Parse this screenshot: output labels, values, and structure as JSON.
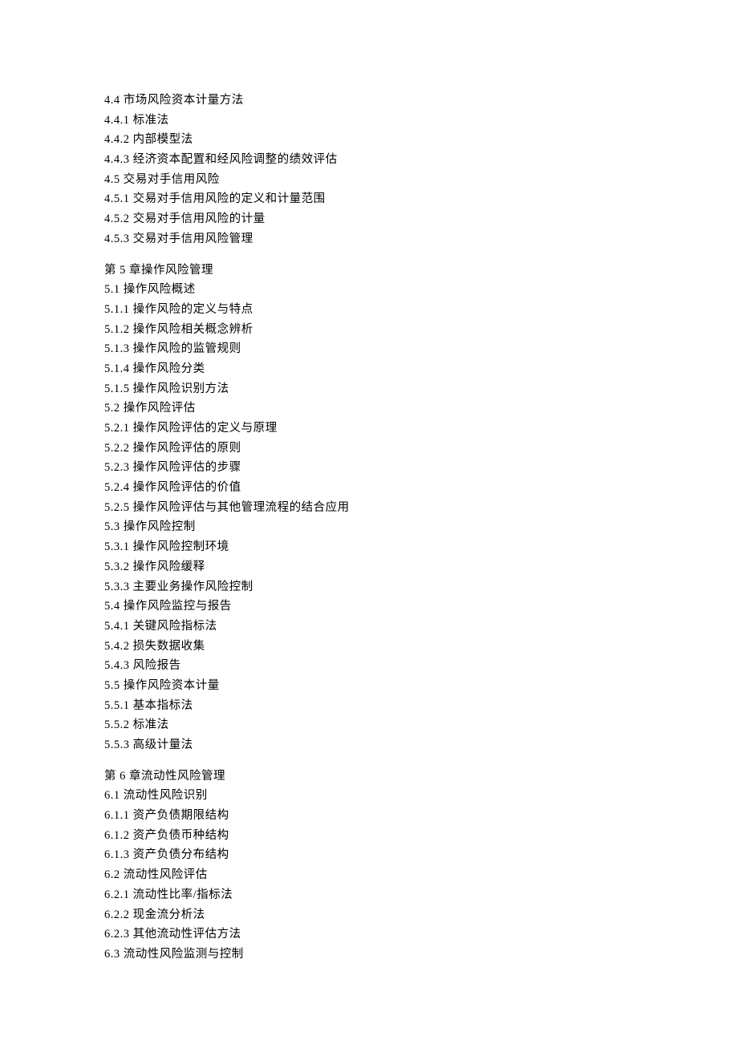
{
  "toc": {
    "blocks": [
      {
        "lines": [
          "4.4 市场风险资本计量方法",
          "4.4.1 标准法",
          "4.4.2 内部模型法",
          "4.4.3 经济资本配置和经风险调整的绩效评估",
          "4.5 交易对手信用风险",
          "4.5.1 交易对手信用风险的定义和计量范围",
          "4.5.2 交易对手信用风险的计量",
          "4.5.3 交易对手信用风险管理"
        ]
      },
      {
        "lines": [
          "第 5 章操作风险管理",
          "5.1 操作风险概述",
          "5.1.1 操作风险的定义与特点",
          "5.1.2 操作风险相关概念辨析",
          "5.1.3 操作风险的监管规则",
          "5.1.4 操作风险分类",
          "5.1.5 操作风险识别方法",
          "5.2 操作风险评估",
          "5.2.1 操作风险评估的定义与原理",
          "5.2.2 操作风险评估的原则",
          "5.2.3 操作风险评估的步骤",
          "5.2.4 操作风险评估的价值",
          "5.2.5 操作风险评估与其他管理流程的结合应用",
          "5.3 操作风险控制",
          "5.3.1 操作风险控制环境",
          "5.3.2 操作风险缓释",
          "5.3.3 主要业务操作风险控制",
          "5.4 操作风险监控与报告",
          "5.4.1 关键风险指标法",
          "5.4.2 损失数据收集",
          "5.4.3 风险报告",
          "5.5 操作风险资本计量",
          "5.5.1 基本指标法",
          "5.5.2 标准法",
          "5.5.3 高级计量法"
        ]
      },
      {
        "lines": [
          "第 6 章流动性风险管理",
          "6.1 流动性风险识别",
          "6.1.1 资产负债期限结构",
          "6.1.2 资产负债币种结构",
          "6.1.3 资产负债分布结构",
          "6.2 流动性风险评估",
          "6.2.1 流动性比率/指标法",
          "6.2.2 现金流分析法",
          "6.2.3 其他流动性评估方法",
          "6.3 流动性风险监测与控制"
        ]
      }
    ]
  }
}
